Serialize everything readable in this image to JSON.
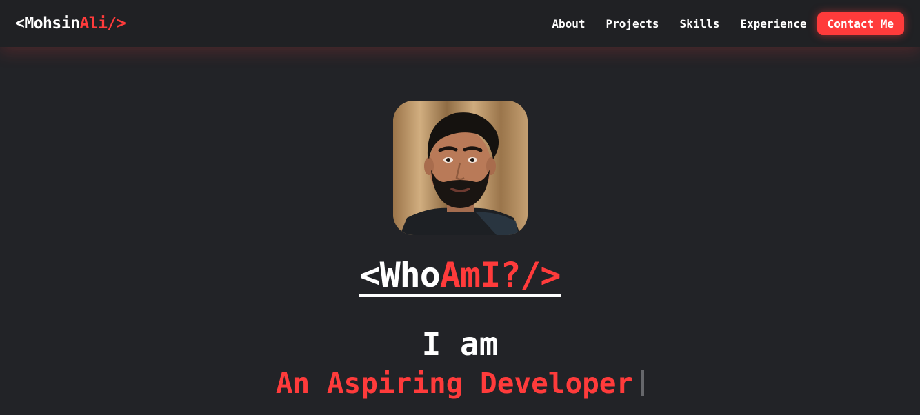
{
  "nav": {
    "logo": {
      "open": "<Mohsin",
      "accent": "Ali/>"
    },
    "links": [
      "About",
      "Projects",
      "Skills",
      "Experience"
    ],
    "contact_label": "Contact Me"
  },
  "hero": {
    "avatar_alt": "profile-photo",
    "title": {
      "open": "<Who",
      "accent": "AmI?/>"
    },
    "intro": "I am",
    "role": "An Aspiring Developer"
  },
  "colors": {
    "background": "#222327",
    "navbar": "#202124",
    "accent": "#ff3b3b",
    "text": "#ffffff"
  }
}
